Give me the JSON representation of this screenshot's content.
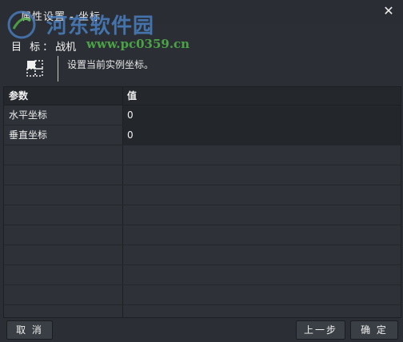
{
  "window": {
    "title": "属性设置 - 坐标",
    "close_symbol": "✕"
  },
  "watermark": {
    "name": "河东软件园",
    "url": "www.pc0359.cn"
  },
  "target": {
    "label": "目  标：",
    "value": "战机"
  },
  "description": {
    "icon": "coordinate-frame-icon",
    "text": "设置当前实例坐标。"
  },
  "grid": {
    "headers": [
      "参数",
      "值"
    ],
    "rows": [
      {
        "param": "水平坐标",
        "value": "0"
      },
      {
        "param": "垂直坐标",
        "value": "0"
      },
      {
        "param": "",
        "value": ""
      },
      {
        "param": "",
        "value": ""
      },
      {
        "param": "",
        "value": ""
      },
      {
        "param": "",
        "value": ""
      },
      {
        "param": "",
        "value": ""
      },
      {
        "param": "",
        "value": ""
      },
      {
        "param": "",
        "value": ""
      },
      {
        "param": "",
        "value": ""
      },
      {
        "param": "",
        "value": ""
      }
    ]
  },
  "buttons": {
    "cancel": "取 消",
    "prev": "上一步",
    "ok": "确 定"
  }
}
